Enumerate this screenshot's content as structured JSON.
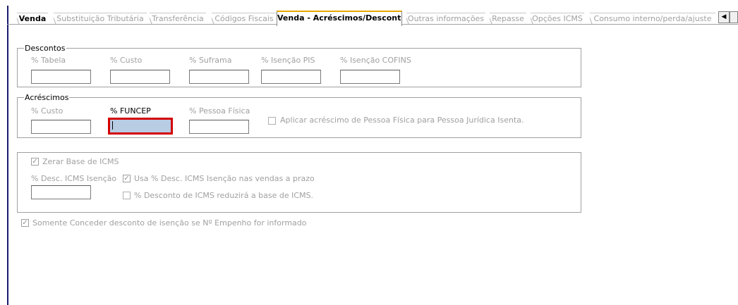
{
  "tabs": [
    {
      "label": "Venda",
      "state": "first"
    },
    {
      "label": "Substituição Tributária",
      "state": "disabled"
    },
    {
      "label": "Transferência",
      "state": "disabled"
    },
    {
      "label": "Códigos Fiscais",
      "state": "disabled"
    },
    {
      "label": "Venda - Acréscimos/Descontos",
      "state": "active"
    },
    {
      "label": "Outras informações",
      "state": "disabled"
    },
    {
      "label": "Repasse",
      "state": "disabled"
    },
    {
      "label": "Opções ICMS",
      "state": "disabled"
    },
    {
      "label": "Consumo interno/perda/ajuste",
      "state": "disabled"
    }
  ],
  "tab_scroll": {
    "left": "◀"
  },
  "descontos": {
    "title": "Descontos",
    "fields": [
      {
        "label": "% Tabela",
        "value": ""
      },
      {
        "label": "% Custo",
        "value": ""
      },
      {
        "label": "% Suframa",
        "value": ""
      },
      {
        "label": "% Isenção PIS",
        "value": ""
      },
      {
        "label": "% Isenção COFINS",
        "value": ""
      }
    ]
  },
  "acrescimos": {
    "title": "Acréscimos",
    "fields": [
      {
        "label": "% Custo",
        "value": ""
      },
      {
        "label": "% FUNCEP",
        "value": "",
        "focused": true
      },
      {
        "label": "% Pessoa Física",
        "value": ""
      }
    ],
    "checkbox_pj": {
      "label": "Aplicar acréscimo de Pessoa Física para Pessoa Jurídica Isenta.",
      "checked": false
    }
  },
  "icms": {
    "zerar_base": {
      "label": "Zerar Base de ICMS",
      "checked": true
    },
    "desc_icms_isencao": {
      "label": "% Desc. ICMS Isenção",
      "value": ""
    },
    "usa_desc": {
      "label": "Usa % Desc. ICMS Isenção nas vendas a prazo",
      "checked": true
    },
    "reduzira_base": {
      "label": "% Desconto de ICMS reduzirá a base de ICMS.",
      "checked": false
    }
  },
  "empenho": {
    "label": "Somente Conceder desconto de isenção se Nº Empenho for informado",
    "checked": true
  },
  "colors": {
    "focus_border": "#d40000",
    "focus_fill": "#b8cce4",
    "active_tab_accent": "#e8a800",
    "disabled_text": "#a0a0a0"
  }
}
